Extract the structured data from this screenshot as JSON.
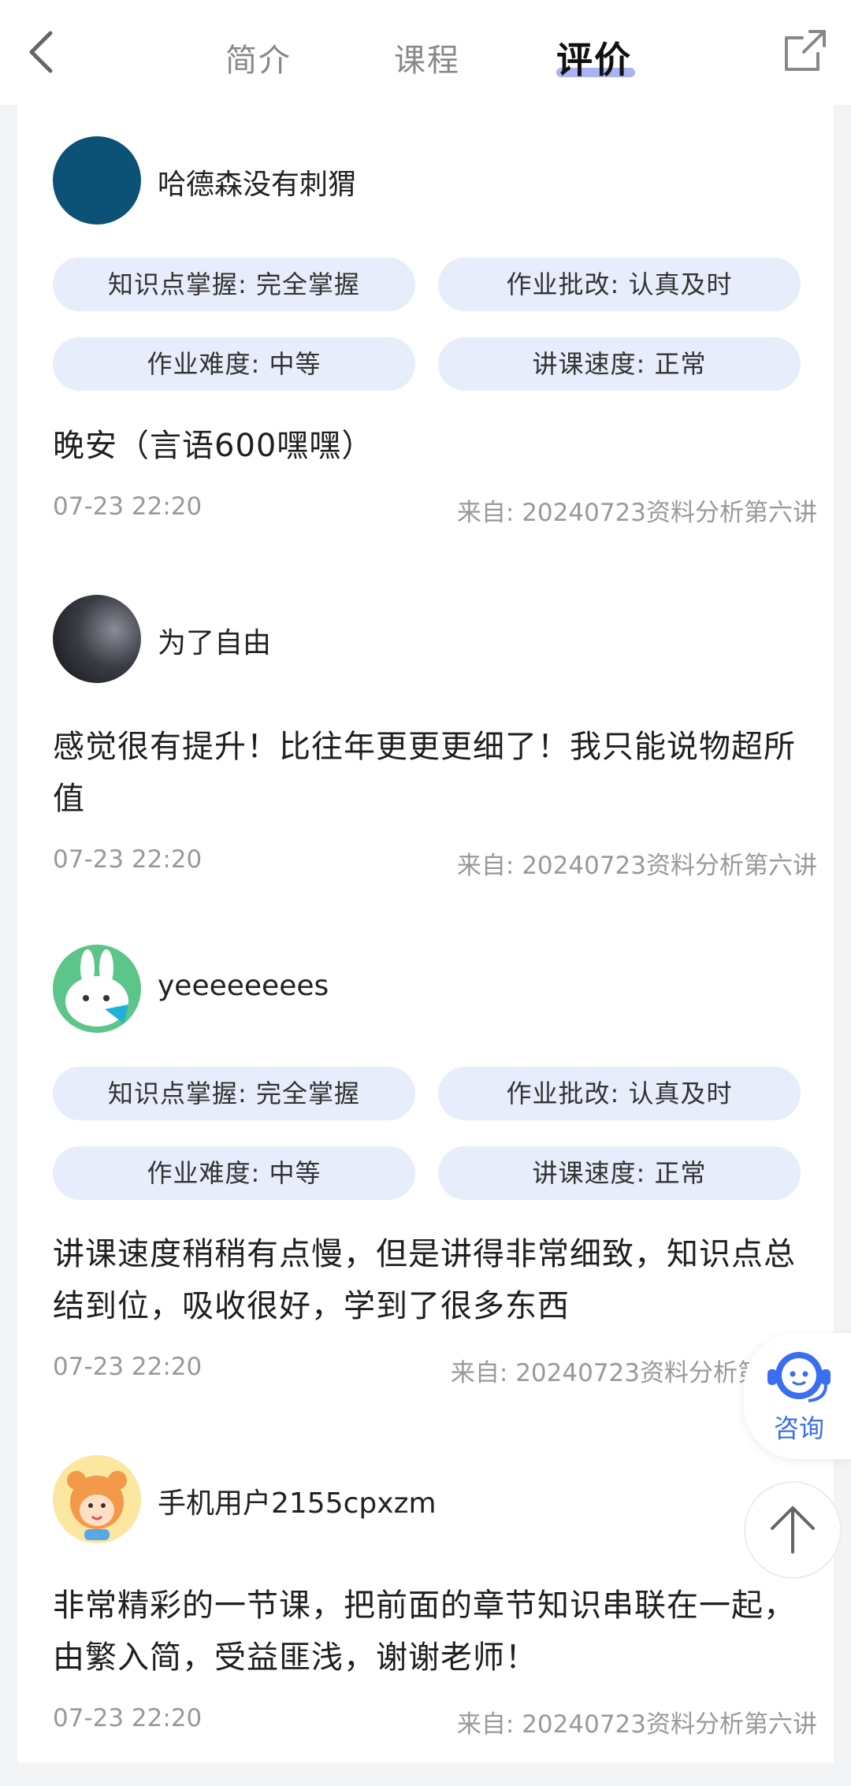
{
  "nav": {
    "tabs": [
      "简介",
      "课程",
      "评价"
    ],
    "active_tab": "评价"
  },
  "reviews": [
    {
      "user": "哈德森没有刺猬",
      "tags": [
        "知识点掌握: 完全掌握",
        "作业批改: 认真及时",
        "作业难度: 中等",
        "讲课速度: 正常"
      ],
      "content": "晚安（言语600嘿嘿）",
      "time": "07-23 22:20",
      "source": "来自: 20240723资料分析第六讲"
    },
    {
      "user": "为了自由",
      "tags": [],
      "content": "感觉很有提升！比往年更更更细了！我只能说物超所值",
      "time": "07-23 22:20",
      "source": "来自: 20240723资料分析第六讲"
    },
    {
      "user": "yeeeeeeees",
      "tags": [
        "知识点掌握: 完全掌握",
        "作业批改: 认真及时",
        "作业难度: 中等",
        "讲课速度: 正常"
      ],
      "content": "讲课速度稍稍有点慢，但是讲得非常细致，知识点总结到位，吸收很好，学到了很多东西",
      "time": "07-23 22:20",
      "source": "来自: 20240723资料分析第"
    },
    {
      "user": "手机用户2155cpxzm",
      "tags": [],
      "content": "非常精彩的一节课，把前面的章节知识串联在一起，由繁入简，受益匪浅，谢谢老师！",
      "time": "07-23 22:20",
      "source": "来自: 20240723资料分析第六讲"
    }
  ],
  "floating": {
    "consult_label": "咨询"
  },
  "icons": {
    "back": "chevron-left-icon",
    "share": "share-icon",
    "consult": "customer-service-icon",
    "to_top": "arrow-up-icon"
  },
  "colors": {
    "accent": "#3a6df0",
    "tag_bg": "#e8edfb",
    "tab_underline": "#aab4f2"
  }
}
